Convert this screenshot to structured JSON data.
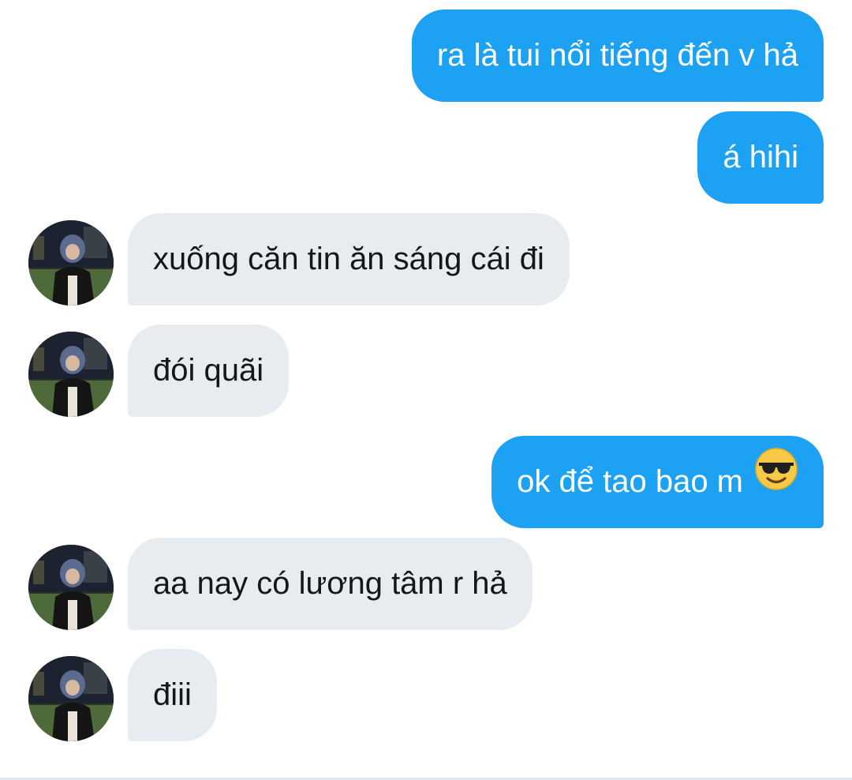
{
  "conversation": {
    "messages": [
      {
        "direction": "sent",
        "text": "ra là tui nổi tiếng đến v hả"
      },
      {
        "direction": "sent",
        "text": "á hihi"
      },
      {
        "direction": "received",
        "text": "xuống căn tin ăn sáng cái đi",
        "avatar": "user-avatar"
      },
      {
        "direction": "received",
        "text": "đói quãi",
        "avatar": "user-avatar"
      },
      {
        "direction": "sent",
        "text": "ok để tao bao m",
        "emoji": "sunglasses-emoji"
      },
      {
        "direction": "received",
        "text": "aa nay có lương tâm r hả",
        "avatar": "user-avatar"
      },
      {
        "direction": "received",
        "text": "điii",
        "avatar": "user-avatar"
      }
    ]
  },
  "colors": {
    "sent_bubble": "#1da1f2",
    "received_bubble": "#e6ecf0",
    "sent_text": "#ffffff",
    "received_text": "#14171a"
  }
}
